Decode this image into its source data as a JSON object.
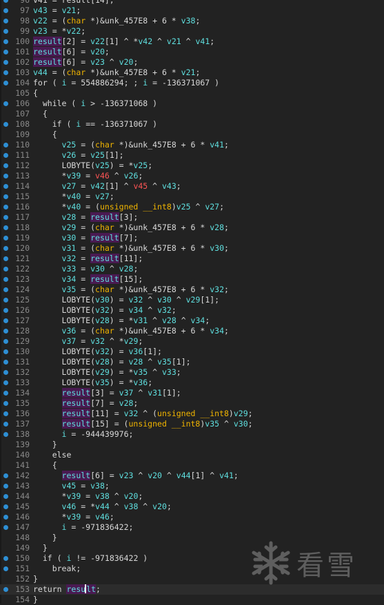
{
  "editor": {
    "lines": [
      {
        "n": "96",
        "bp": true,
        "html": "v41 = result[14];"
      },
      {
        "n": "97",
        "bp": true,
        "html": "<span class=\"v\">v43</span> = <span class=\"v\">v21</span>;"
      },
      {
        "n": "98",
        "bp": true,
        "html": "<span class=\"v\">v22</span> = (<span class=\"ty\">char</span> *)&amp;unk_457E8 + 6 * <span class=\"v\">v38</span>;"
      },
      {
        "n": "99",
        "bp": true,
        "html": "<span class=\"v\">v23</span> = *<span class=\"v\">v22</span>;"
      },
      {
        "n": "100",
        "bp": true,
        "html": "<span class=\"res\">result</span>[2] = <span class=\"v\">v22</span>[1] ^ *<span class=\"v\">v42</span> ^ <span class=\"v\">v21</span> ^ <span class=\"v\">v41</span>;"
      },
      {
        "n": "101",
        "bp": true,
        "html": "<span class=\"res\">result</span>[6] = <span class=\"v\">v20</span>;"
      },
      {
        "n": "102",
        "bp": true,
        "html": "<span class=\"res\">result</span>[6] = <span class=\"v\">v23</span> ^ <span class=\"v\">v20</span>;"
      },
      {
        "n": "103",
        "bp": true,
        "html": "<span class=\"v\">v44</span> = (<span class=\"ty\">char</span> *)&amp;unk_457E8 + 6 * <span class=\"v\">v21</span>;"
      },
      {
        "n": "104",
        "bp": true,
        "html": "<span class=\"kw\">for</span> ( <span class=\"v\">i</span> = 554886294; ; <span class=\"v\">i</span> = -136371067 )"
      },
      {
        "n": "105",
        "bp": false,
        "html": "{"
      },
      {
        "n": "106",
        "bp": true,
        "html": "  <span class=\"kw\">while</span> ( <span class=\"v\">i</span> &gt; -136371068 )"
      },
      {
        "n": "107",
        "bp": false,
        "html": "  {"
      },
      {
        "n": "108",
        "bp": true,
        "html": "    <span class=\"kw\">if</span> ( <span class=\"v\">i</span> == -136371067 )"
      },
      {
        "n": "109",
        "bp": false,
        "html": "    {"
      },
      {
        "n": "110",
        "bp": true,
        "html": "      <span class=\"v\">v25</span> = (<span class=\"ty\">char</span> *)&amp;unk_457E8 + 6 * <span class=\"v\">v41</span>;"
      },
      {
        "n": "111",
        "bp": true,
        "html": "      <span class=\"v\">v26</span> = <span class=\"v\">v25</span>[1];"
      },
      {
        "n": "112",
        "bp": true,
        "html": "      LOBYTE(<span class=\"v\">v25</span>) = *<span class=\"v\">v25</span>;"
      },
      {
        "n": "113",
        "bp": true,
        "html": "      *<span class=\"v\">v39</span> = <span class=\"hl\">v46</span> ^ <span class=\"v\">v26</span>;"
      },
      {
        "n": "114",
        "bp": true,
        "html": "      <span class=\"v\">v27</span> = <span class=\"v\">v42</span>[1] ^ <span class=\"hl\">v45</span> ^ <span class=\"v\">v43</span>;"
      },
      {
        "n": "115",
        "bp": true,
        "html": "      *<span class=\"v\">v40</span> = <span class=\"v\">v27</span>;"
      },
      {
        "n": "116",
        "bp": true,
        "html": "      *<span class=\"v\">v40</span> = (<span class=\"ty\">unsigned __int8</span>)<span class=\"v\">v25</span> ^ <span class=\"v\">v27</span>;"
      },
      {
        "n": "117",
        "bp": true,
        "html": "      <span class=\"v\">v28</span> = <span class=\"res\">result</span>[3];"
      },
      {
        "n": "118",
        "bp": true,
        "html": "      <span class=\"v\">v29</span> = (<span class=\"ty\">char</span> *)&amp;unk_457E8 + 6 * <span class=\"v\">v28</span>;"
      },
      {
        "n": "119",
        "bp": true,
        "html": "      <span class=\"v\">v30</span> = <span class=\"res\">result</span>[7];"
      },
      {
        "n": "120",
        "bp": true,
        "html": "      <span class=\"v\">v31</span> = (<span class=\"ty\">char</span> *)&amp;unk_457E8 + 6 * <span class=\"v\">v30</span>;"
      },
      {
        "n": "121",
        "bp": true,
        "html": "      <span class=\"v\">v32</span> = <span class=\"res\">result</span>[11];"
      },
      {
        "n": "122",
        "bp": true,
        "html": "      <span class=\"v\">v33</span> = <span class=\"v\">v30</span> ^ <span class=\"v\">v28</span>;"
      },
      {
        "n": "123",
        "bp": true,
        "html": "      <span class=\"v\">v34</span> = <span class=\"res\">result</span>[15];"
      },
      {
        "n": "124",
        "bp": true,
        "html": "      <span class=\"v\">v35</span> = (<span class=\"ty\">char</span> *)&amp;unk_457E8 + 6 * <span class=\"v\">v32</span>;"
      },
      {
        "n": "125",
        "bp": true,
        "html": "      LOBYTE(<span class=\"v\">v30</span>) = <span class=\"v\">v32</span> ^ <span class=\"v\">v30</span> ^ <span class=\"v\">v29</span>[1];"
      },
      {
        "n": "126",
        "bp": true,
        "html": "      LOBYTE(<span class=\"v\">v32</span>) = <span class=\"v\">v34</span> ^ <span class=\"v\">v32</span>;"
      },
      {
        "n": "127",
        "bp": true,
        "html": "      LOBYTE(<span class=\"v\">v28</span>) = *<span class=\"v\">v31</span> ^ <span class=\"v\">v28</span> ^ <span class=\"v\">v34</span>;"
      },
      {
        "n": "128",
        "bp": true,
        "html": "      <span class=\"v\">v36</span> = (<span class=\"ty\">char</span> *)&amp;unk_457E8 + 6 * <span class=\"v\">v34</span>;"
      },
      {
        "n": "129",
        "bp": true,
        "html": "      <span class=\"v\">v37</span> = <span class=\"v\">v32</span> ^ *<span class=\"v\">v29</span>;"
      },
      {
        "n": "130",
        "bp": true,
        "html": "      LOBYTE(<span class=\"v\">v32</span>) = <span class=\"v\">v36</span>[1];"
      },
      {
        "n": "131",
        "bp": true,
        "html": "      LOBYTE(<span class=\"v\">v28</span>) = <span class=\"v\">v28</span> ^ <span class=\"v\">v35</span>[1];"
      },
      {
        "n": "132",
        "bp": true,
        "html": "      LOBYTE(<span class=\"v\">v29</span>) = *<span class=\"v\">v35</span> ^ <span class=\"v\">v33</span>;"
      },
      {
        "n": "133",
        "bp": true,
        "html": "      LOBYTE(<span class=\"v\">v35</span>) = *<span class=\"v\">v36</span>;"
      },
      {
        "n": "134",
        "bp": true,
        "html": "      <span class=\"res\">result</span>[3] = <span class=\"v\">v37</span> ^ <span class=\"v\">v31</span>[1];"
      },
      {
        "n": "135",
        "bp": true,
        "html": "      <span class=\"res\">result</span>[7] = <span class=\"v\">v28</span>;"
      },
      {
        "n": "136",
        "bp": true,
        "html": "      <span class=\"res\">result</span>[11] = <span class=\"v\">v32</span> ^ (<span class=\"ty\">unsigned __int8</span>)<span class=\"v\">v29</span>;"
      },
      {
        "n": "137",
        "bp": true,
        "html": "      <span class=\"res\">result</span>[15] = (<span class=\"ty\">unsigned __int8</span>)<span class=\"v\">v35</span> ^ <span class=\"v\">v30</span>;"
      },
      {
        "n": "138",
        "bp": true,
        "html": "      <span class=\"v\">i</span> = -944439976;"
      },
      {
        "n": "139",
        "bp": false,
        "html": "    }"
      },
      {
        "n": "140",
        "bp": false,
        "html": "    <span class=\"kw\">else</span>"
      },
      {
        "n": "141",
        "bp": false,
        "html": "    {"
      },
      {
        "n": "142",
        "bp": true,
        "html": "      <span class=\"res\">result</span>[6] = <span class=\"v\">v23</span> ^ <span class=\"v\">v20</span> ^ <span class=\"v\">v44</span>[1] ^ <span class=\"v\">v41</span>;"
      },
      {
        "n": "143",
        "bp": true,
        "html": "      <span class=\"v\">v45</span> = <span class=\"v\">v38</span>;"
      },
      {
        "n": "144",
        "bp": true,
        "html": "      *<span class=\"v\">v39</span> = <span class=\"v\">v38</span> ^ <span class=\"v\">v20</span>;"
      },
      {
        "n": "145",
        "bp": true,
        "html": "      <span class=\"v\">v46</span> = *<span class=\"v\">v44</span> ^ <span class=\"v\">v38</span> ^ <span class=\"v\">v20</span>;"
      },
      {
        "n": "146",
        "bp": true,
        "html": "      *<span class=\"v\">v39</span> = <span class=\"v\">v46</span>;"
      },
      {
        "n": "147",
        "bp": true,
        "html": "      <span class=\"v\">i</span> = -971836422;"
      },
      {
        "n": "148",
        "bp": false,
        "html": "    }"
      },
      {
        "n": "149",
        "bp": false,
        "html": "  }"
      },
      {
        "n": "150",
        "bp": true,
        "html": "  <span class=\"kw\">if</span> ( <span class=\"v\">i</span> != -971836422 )"
      },
      {
        "n": "151",
        "bp": true,
        "html": "    <span class=\"kw\">break</span>;"
      },
      {
        "n": "152",
        "bp": false,
        "html": "}"
      },
      {
        "n": "153",
        "bp": true,
        "cur": true,
        "html": "<span class=\"kw\">return</span> <span class=\"res\">resu<span class=\"cursor\"></span>lt</span>;"
      },
      {
        "n": "154",
        "bp": false,
        "html": "}"
      }
    ]
  },
  "watermark": {
    "text": "看雪",
    "icon": "snowflake-icon"
  }
}
